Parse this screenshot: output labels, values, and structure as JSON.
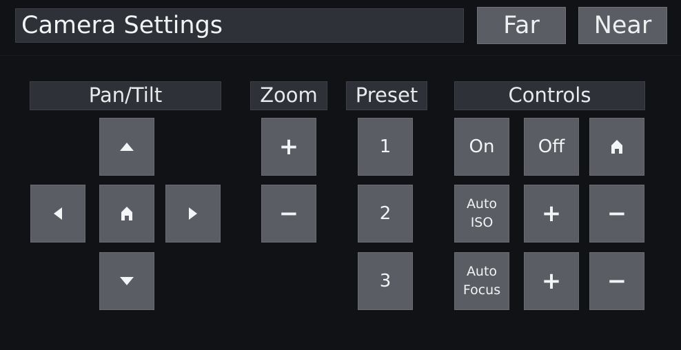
{
  "header": {
    "title": "Camera Settings",
    "far_label": "Far",
    "near_label": "Near"
  },
  "sections": {
    "pan_tilt": "Pan/Tilt",
    "zoom": "Zoom",
    "preset": "Preset",
    "controls": "Controls"
  },
  "pan_tilt": {
    "up_icon": "triangle-up-icon",
    "down_icon": "triangle-down-icon",
    "left_icon": "triangle-left-icon",
    "right_icon": "triangle-right-icon",
    "home_icon": "home-icon"
  },
  "zoom": {
    "in_label": "+",
    "out_label": "−"
  },
  "presets": [
    "1",
    "2",
    "3"
  ],
  "controls": {
    "on_label": "On",
    "off_label": "Off",
    "home_icon": "home-icon",
    "auto_iso_line1": "Auto",
    "auto_iso_line2": "ISO",
    "iso_plus": "+",
    "iso_minus": "−",
    "auto_focus_line1": "Auto",
    "auto_focus_line2": "Focus",
    "focus_plus": "+",
    "focus_minus": "−"
  },
  "colors": {
    "background": "#111215",
    "button": "#5a5e64",
    "label_bg": "#2e3238",
    "text": "#eceef0"
  }
}
